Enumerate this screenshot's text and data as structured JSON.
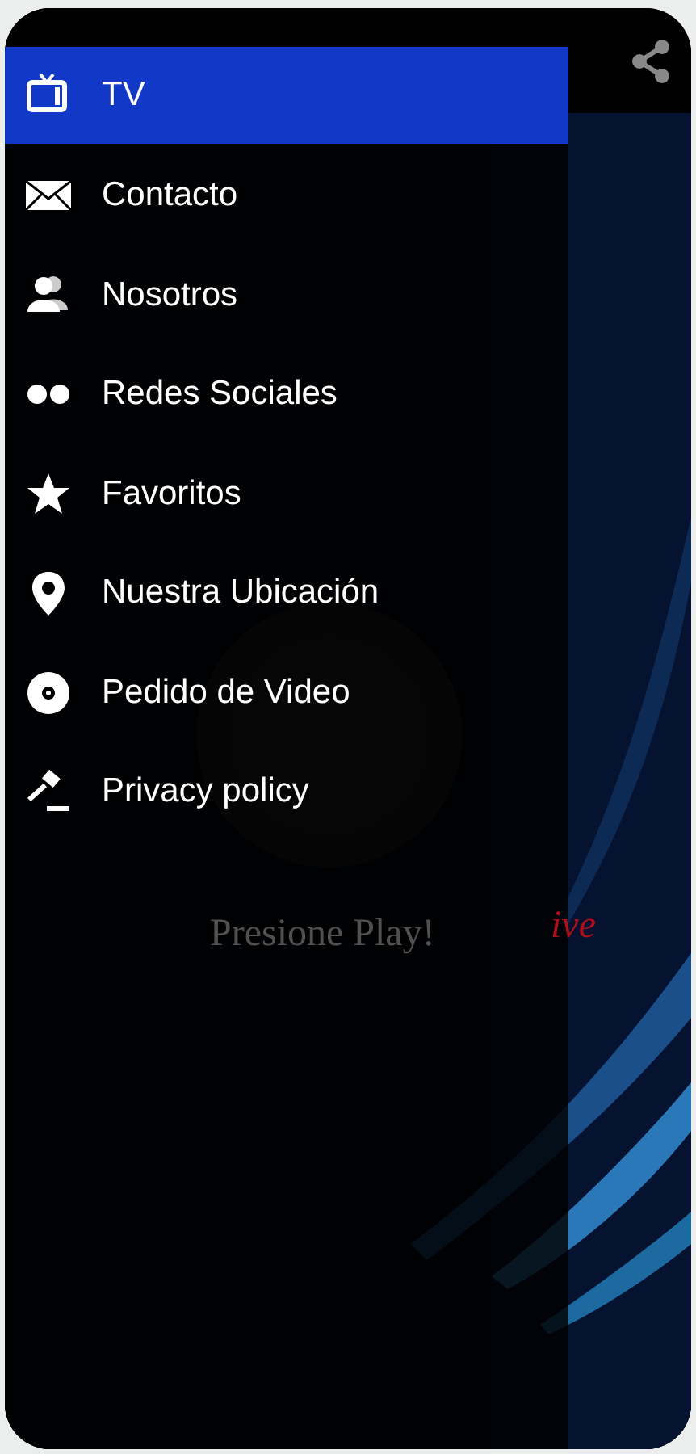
{
  "background": {
    "kind": "picture",
    "caption": "Presione Play!",
    "caption_tail": "ive"
  },
  "drawer": {
    "items": [
      {
        "label": "TV",
        "selected": true
      },
      {
        "label": "Contacto",
        "selected": false
      },
      {
        "label": "Nosotros",
        "selected": false
      },
      {
        "label": "Redes Sociales",
        "selected": false
      },
      {
        "label": "Favoritos",
        "selected": false
      },
      {
        "label": "Nuestra Ubicación",
        "selected": false
      },
      {
        "label": "Pedido de Video",
        "selected": false
      },
      {
        "label": "Privacy policy",
        "selected": false
      }
    ]
  }
}
